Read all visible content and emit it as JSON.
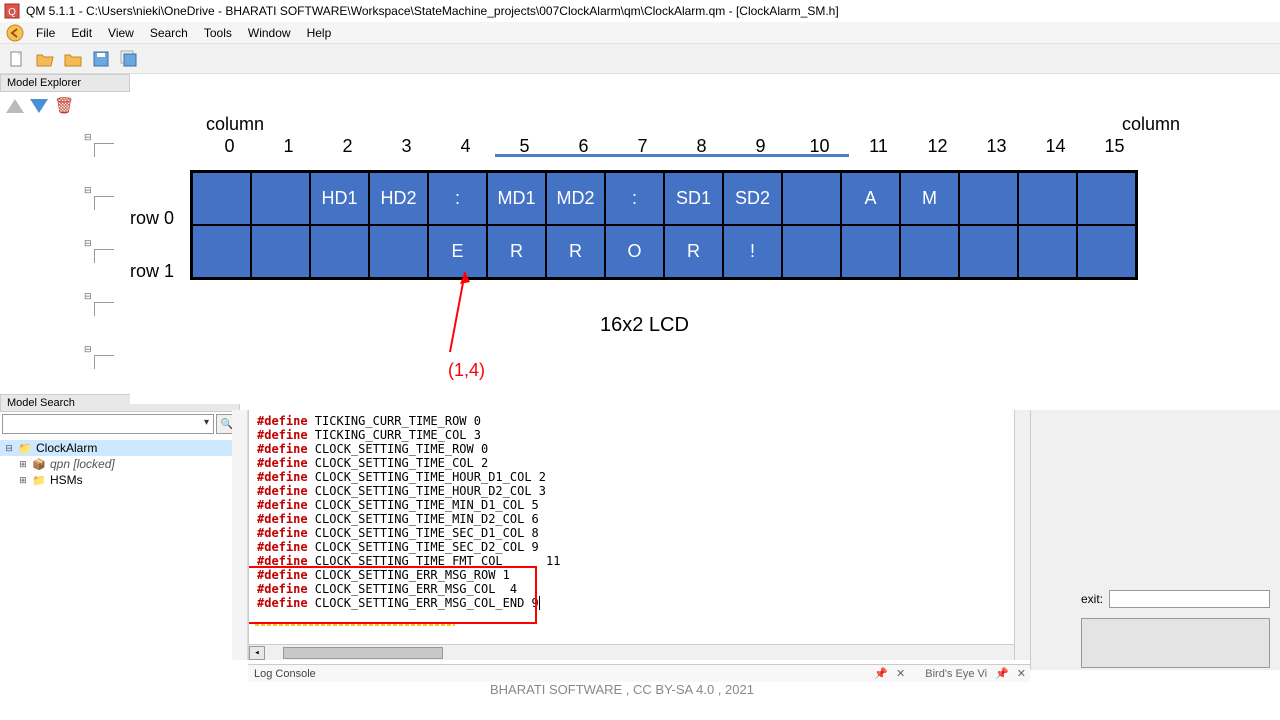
{
  "window": {
    "title": "QM 5.1.1 - C:\\Users\\nieki\\OneDrive - BHARATI SOFTWARE\\Workspace\\StateMachine_projects\\007ClockAlarm\\qm\\ClockAlarm.qm - [ClockAlarm_SM.h]"
  },
  "menu": {
    "file": "File",
    "edit": "Edit",
    "view": "View",
    "search": "Search",
    "tools": "Tools",
    "window": "Window",
    "help": "Help"
  },
  "panels": {
    "model_explorer": "Model Explorer",
    "model_search": "Model Search",
    "log_console": "Log Console",
    "birds_eye": "Bird's Eye Vi"
  },
  "tree": {
    "root": "ClockAlarm",
    "qpn": "qpn [locked]",
    "hsms": "HSMs"
  },
  "diagram": {
    "col_label": "column",
    "cols": [
      "0",
      "1",
      "2",
      "3",
      "4",
      "5",
      "6",
      "7",
      "8",
      "9",
      "10",
      "11",
      "12",
      "13",
      "14",
      "15"
    ],
    "row0_label": "row 0",
    "row1_label": "row 1",
    "row0": [
      "",
      "",
      "HD1",
      "HD2",
      ":",
      "MD1",
      "MD2",
      ":",
      "SD1",
      "SD2",
      "",
      "A",
      "M",
      "",
      "",
      ""
    ],
    "row1": [
      "",
      "",
      "",
      "",
      "E",
      "R",
      "R",
      "O",
      "R",
      "!",
      "",
      "",
      "",
      "",
      "",
      ""
    ],
    "caption": "16x2 LCD",
    "pointer": "(1,4)",
    "underline_start": 5,
    "underline_end": 10
  },
  "code": {
    "defines": [
      {
        "name": "TICKING_CURR_TIME_ROW",
        "val": "0"
      },
      {
        "name": "TICKING_CURR_TIME_COL",
        "val": "3"
      },
      {
        "name": "CLOCK_SETTING_TIME_ROW",
        "val": "0"
      },
      {
        "name": "CLOCK_SETTING_TIME_COL",
        "val": "2"
      },
      {
        "name": "CLOCK_SETTING_TIME_HOUR_D1_COL",
        "val": "2"
      },
      {
        "name": "CLOCK_SETTING_TIME_HOUR_D2_COL",
        "val": "3"
      },
      {
        "name": "CLOCK_SETTING_TIME_MIN_D1_COL",
        "val": "5"
      },
      {
        "name": "CLOCK_SETTING_TIME_MIN_D2_COL",
        "val": "6"
      },
      {
        "name": "CLOCK_SETTING_TIME_SEC_D1_COL",
        "val": "8"
      },
      {
        "name": "CLOCK_SETTING_TIME_SEC_D2_COL",
        "val": "9"
      },
      {
        "name": "CLOCK_SETTING_TIME_FMT_COL",
        "val": "     11"
      },
      {
        "name": "CLOCK_SETTING_ERR_MSG_ROW",
        "val": "1"
      },
      {
        "name": "CLOCK_SETTING_ERR_MSG_COL",
        "val": " 4"
      },
      {
        "name": "CLOCK_SETTING_ERR_MSG_COL_END",
        "val": "9"
      }
    ],
    "keyword": "#define"
  },
  "right": {
    "exit_label": "exit:"
  },
  "footer": "BHARATI SOFTWARE , CC BY-SA 4.0 , 2021"
}
